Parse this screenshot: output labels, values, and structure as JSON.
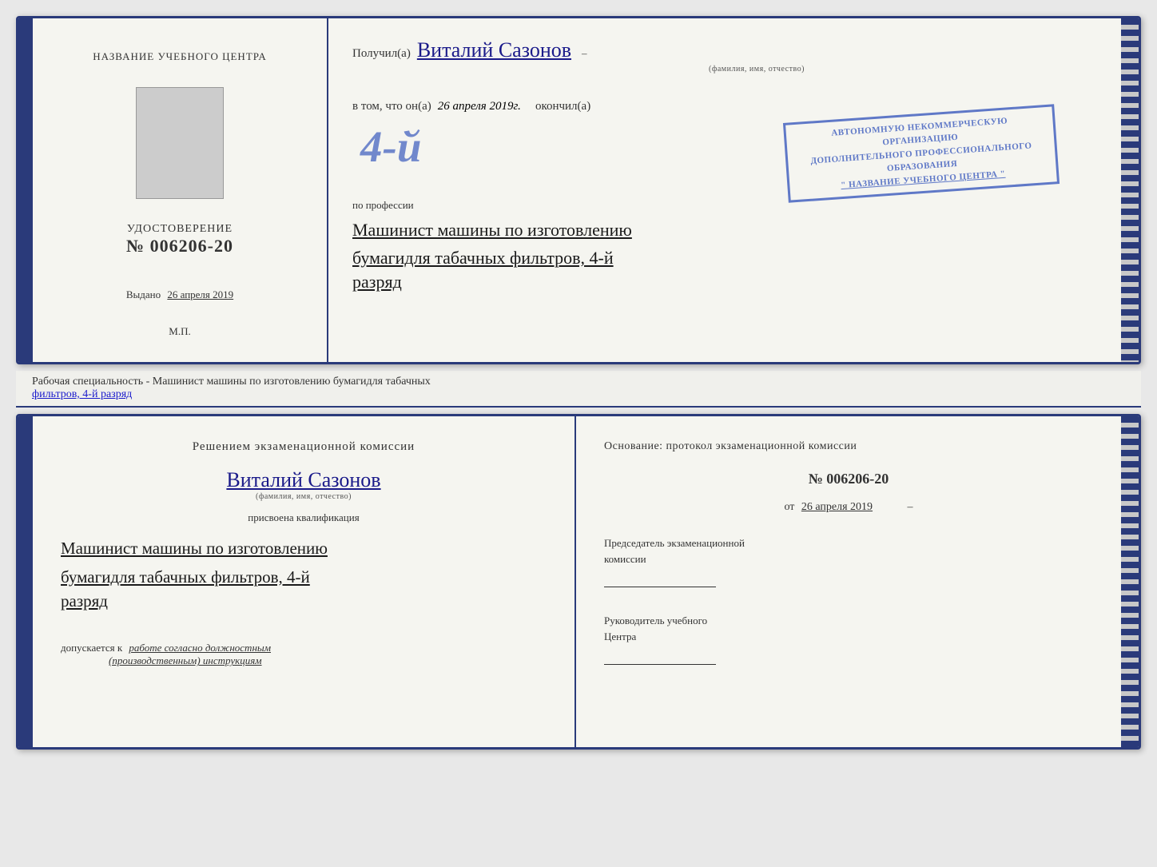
{
  "top": {
    "left": {
      "training_center_label": "НАЗВАНИЕ УЧЕБНОГО ЦЕНТРА",
      "cert_title": "УДОСТОВЕРЕНИЕ",
      "cert_number": "№ 006206-20",
      "issued_label": "Выдано",
      "issued_date": "26 апреля 2019",
      "mp_label": "М.П."
    },
    "right": {
      "received_prefix": "Получил(а)",
      "received_name": "Виталий Сазонов",
      "fio_label": "(фамилия, имя, отчество)",
      "vtom_prefix": "в том, что он(а)",
      "vtom_date": "26 апреля 2019г.",
      "okончил": "окончил(а)",
      "stamp_big": "4-й",
      "stamp_line1": "АВТОНОМНУЮ НЕКОММЕРЧЕСКУЮ ОРГАНИЗАЦИЮ",
      "stamp_line2": "ДОПОЛНИТЕЛЬНОГО ПРОФЕССИОНАЛЬНОГО ОБРАЗОВАНИЯ",
      "stamp_line3": "\" НАЗВАНИЕ УЧЕБНОГО ЦЕНТРА \"",
      "by_profession": "по профессии",
      "profession_line1": "Машинист машины по изготовлению",
      "profession_line2": "бумагидля табачных фильтров, 4-й",
      "profession_line3": "разряд"
    }
  },
  "middle": {
    "text_plain": "Рабочая специальность - Машинист машины по изготовлению бумагидля табачных",
    "text_underline": "фильтров, 4-й разряд"
  },
  "bottom": {
    "left": {
      "decision_title": "Решением экзаменационной комиссии",
      "person_name": "Виталий Сазонов",
      "fio_label": "(фамилия, имя, отчество)",
      "qualification_label": "присвоена квалификация",
      "qual_line1": "Машинист машины по изготовлению",
      "qual_line2": "бумагидля табачных фильтров, 4-й",
      "qual_line3": "разряд",
      "dopuskaetsya_prefix": "допускается к",
      "dopuskaetsya_value": "работе согласно должностным",
      "dopuskaetsya_value2": "(производственным) инструкциям"
    },
    "right": {
      "osnovaniye": "Основание: протокол экзаменационной комиссии",
      "protocol_number": "№ 006206-20",
      "protocol_date_prefix": "от",
      "protocol_date": "26 апреля 2019",
      "chairman_label": "Председатель экзаменационной",
      "chairman_label2": "комиссии",
      "director_label": "Руководитель учебного",
      "director_label2": "Центра"
    }
  }
}
